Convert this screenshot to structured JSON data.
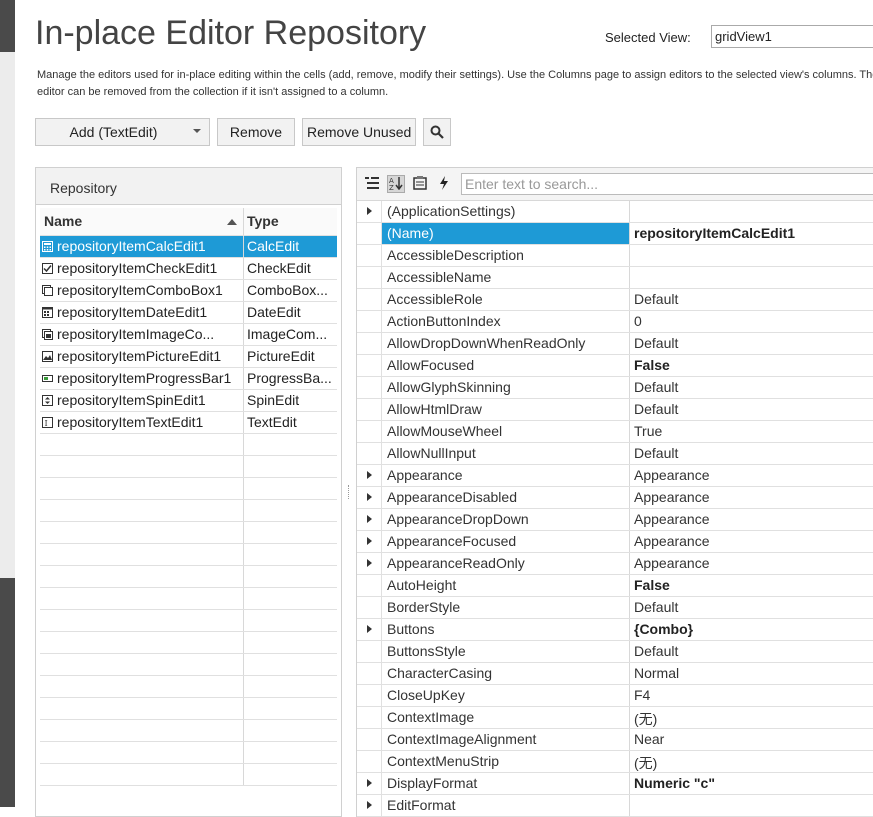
{
  "header": {
    "title": "In-place Editor Repository",
    "selected_view_label": "Selected View:",
    "selected_view_value": "gridView1",
    "description": "Manage the editors used for in-place editing within the cells (add, remove, modify their settings). Use the Columns page to assign editors to the selected view's columns. The editor can be removed from the collection if it isn't assigned to a column."
  },
  "toolbar": {
    "add_label": "Add (TextEdit)",
    "remove_label": "Remove",
    "remove_unused_label": "Remove Unused"
  },
  "repository": {
    "header": "Repository",
    "col_name": "Name",
    "col_type": "Type",
    "items": [
      {
        "name": "repositoryItemCalcEdit1",
        "type": "CalcEdit",
        "icon": "calculator-icon",
        "selected": true
      },
      {
        "name": "repositoryItemCheckEdit1",
        "type": "CheckEdit",
        "icon": "checkbox-icon",
        "selected": false
      },
      {
        "name": "repositoryItemComboBox1",
        "type": "ComboBox...",
        "icon": "combobox-icon",
        "selected": false
      },
      {
        "name": "repositoryItemDateEdit1",
        "type": "DateEdit",
        "icon": "calendar-icon",
        "selected": false
      },
      {
        "name": "repositoryItemImageCo...",
        "type": "ImageCom...",
        "icon": "image-combo-icon",
        "selected": false
      },
      {
        "name": "repositoryItemPictureEdit1",
        "type": "PictureEdit",
        "icon": "picture-icon",
        "selected": false
      },
      {
        "name": "repositoryItemProgressBar1",
        "type": "ProgressBa...",
        "icon": "progress-bar-icon",
        "selected": false
      },
      {
        "name": "repositoryItemSpinEdit1",
        "type": "SpinEdit",
        "icon": "spin-icon",
        "selected": false
      },
      {
        "name": "repositoryItemTextEdit1",
        "type": "TextEdit",
        "icon": "text-edit-icon",
        "selected": false
      }
    ],
    "empty_rows": 16
  },
  "properties": {
    "search_placeholder": "Enter text to search...",
    "rows": [
      {
        "name": "(ApplicationSettings)",
        "value": "",
        "expandable": true,
        "bold": false
      },
      {
        "name": "(Name)",
        "value": "repositoryItemCalcEdit1",
        "expandable": false,
        "bold": true,
        "selected": true
      },
      {
        "name": "AccessibleDescription",
        "value": "",
        "expandable": false,
        "bold": false
      },
      {
        "name": "AccessibleName",
        "value": "",
        "expandable": false,
        "bold": false
      },
      {
        "name": "AccessibleRole",
        "value": "Default",
        "expandable": false,
        "bold": false
      },
      {
        "name": "ActionButtonIndex",
        "value": "0",
        "expandable": false,
        "bold": false
      },
      {
        "name": "AllowDropDownWhenReadOnly",
        "value": "Default",
        "expandable": false,
        "bold": false
      },
      {
        "name": "AllowFocused",
        "value": "False",
        "expandable": false,
        "bold": true
      },
      {
        "name": "AllowGlyphSkinning",
        "value": "Default",
        "expandable": false,
        "bold": false
      },
      {
        "name": "AllowHtmlDraw",
        "value": "Default",
        "expandable": false,
        "bold": false
      },
      {
        "name": "AllowMouseWheel",
        "value": "True",
        "expandable": false,
        "bold": false
      },
      {
        "name": "AllowNullInput",
        "value": "Default",
        "expandable": false,
        "bold": false
      },
      {
        "name": "Appearance",
        "value": "Appearance",
        "expandable": true,
        "bold": false
      },
      {
        "name": "AppearanceDisabled",
        "value": "Appearance",
        "expandable": true,
        "bold": false
      },
      {
        "name": "AppearanceDropDown",
        "value": "Appearance",
        "expandable": true,
        "bold": false
      },
      {
        "name": "AppearanceFocused",
        "value": "Appearance",
        "expandable": true,
        "bold": false
      },
      {
        "name": "AppearanceReadOnly",
        "value": "Appearance",
        "expandable": true,
        "bold": false
      },
      {
        "name": "AutoHeight",
        "value": "False",
        "expandable": false,
        "bold": true
      },
      {
        "name": "BorderStyle",
        "value": "Default",
        "expandable": false,
        "bold": false
      },
      {
        "name": "Buttons",
        "value": "{Combo}",
        "expandable": true,
        "bold": true
      },
      {
        "name": "ButtonsStyle",
        "value": "Default",
        "expandable": false,
        "bold": false
      },
      {
        "name": "CharacterCasing",
        "value": "Normal",
        "expandable": false,
        "bold": false
      },
      {
        "name": "CloseUpKey",
        "value": "F4",
        "expandable": false,
        "bold": false
      },
      {
        "name": "ContextImage",
        "value": "(无)",
        "expandable": false,
        "bold": false
      },
      {
        "name": "ContextImageAlignment",
        "value": "Near",
        "expandable": false,
        "bold": false
      },
      {
        "name": "ContextMenuStrip",
        "value": "(无)",
        "expandable": false,
        "bold": false
      },
      {
        "name": "DisplayFormat",
        "value": "Numeric \"c\"",
        "expandable": true,
        "bold": true
      },
      {
        "name": "EditFormat",
        "value": "",
        "expandable": true,
        "bold": false
      }
    ]
  },
  "colors": {
    "selection": "#1e9ad6",
    "panel_header": "#f2f2f2"
  }
}
